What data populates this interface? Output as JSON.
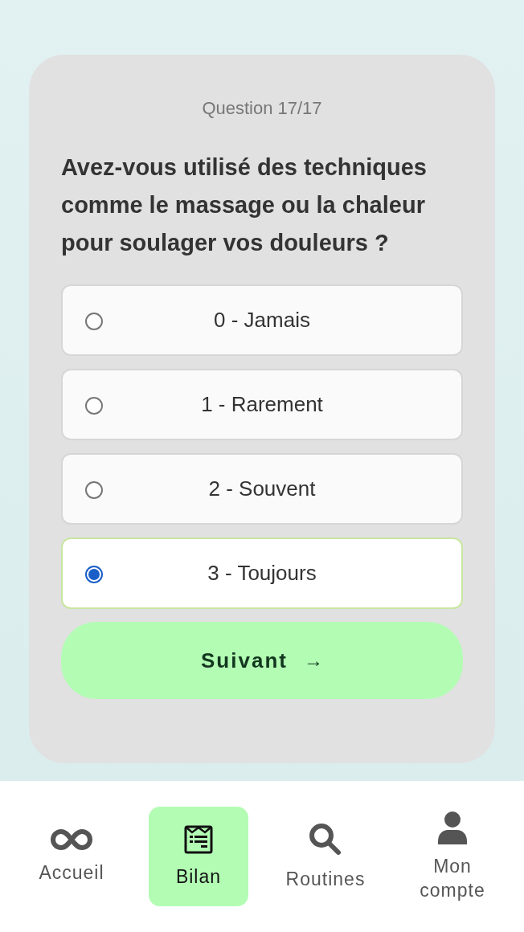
{
  "progress": "Question 17/17",
  "question": "Avez-vous utilisé des techniques comme le massage ou la chaleur pour soulager vos douleurs ?",
  "options": [
    {
      "label": "0 - Jamais",
      "selected": false
    },
    {
      "label": "1 - Rarement",
      "selected": false
    },
    {
      "label": "2 - Souvent",
      "selected": false
    },
    {
      "label": "3 - Toujours",
      "selected": true
    }
  ],
  "next_button": {
    "label": "Suivant",
    "arrow": "→"
  },
  "nav": [
    {
      "kind": "infinity",
      "label": "Accueil",
      "selected": false
    },
    {
      "kind": "report",
      "label": "Bilan",
      "selected": true
    },
    {
      "kind": "search",
      "label": "Routines",
      "selected": false
    },
    {
      "kind": "user",
      "label": "Mon compte",
      "selected": false
    }
  ]
}
